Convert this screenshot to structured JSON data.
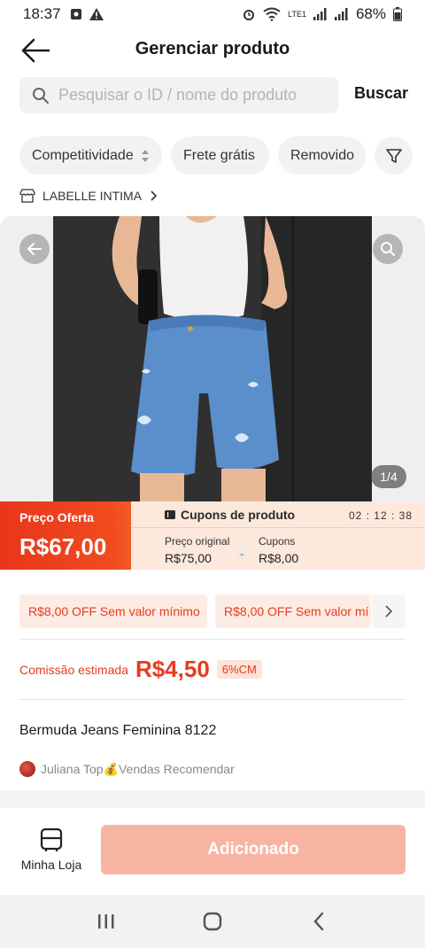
{
  "status_bar": {
    "time": "18:37",
    "battery": "68%",
    "network": "LTE1"
  },
  "header": {
    "title": "Gerenciar produto"
  },
  "search": {
    "placeholder": "Pesquisar o ID / nome do produto",
    "button_label": "Buscar"
  },
  "filters": {
    "chips": [
      "Competitividade",
      "Frete grátis",
      "Removido"
    ]
  },
  "store": {
    "name": "LABELLE INTIMA"
  },
  "gallery": {
    "counter": "1/4"
  },
  "price": {
    "offer_label": "Preço Oferta",
    "offer_value": "R$67,00",
    "coupons_title": "Cupons de produto",
    "timer": "02 : 12 : 38",
    "original_label": "Preço original",
    "original_value": "R$75,00",
    "coupons_label": "Cupons",
    "coupons_value": "R$8,00",
    "minus": "-"
  },
  "vouchers": [
    "R$8,00 OFF Sem valor mínimo",
    "R$8,00 OFF Sem valor mí"
  ],
  "commission": {
    "label": "Comissão estimada",
    "value": "R$4,50",
    "badge": "6%CM"
  },
  "product": {
    "name": "Bermuda Jeans Feminina 8122",
    "recommend_text": "Juliana Top💰Vendas Recomendar"
  },
  "bottom_bar": {
    "store_label": "Minha Loja",
    "add_button": "Adicionado"
  },
  "colors": {
    "accent": "#e53b1e",
    "button_disabled": "#f8b4a3",
    "coupon_bg": "#fde8dc"
  }
}
